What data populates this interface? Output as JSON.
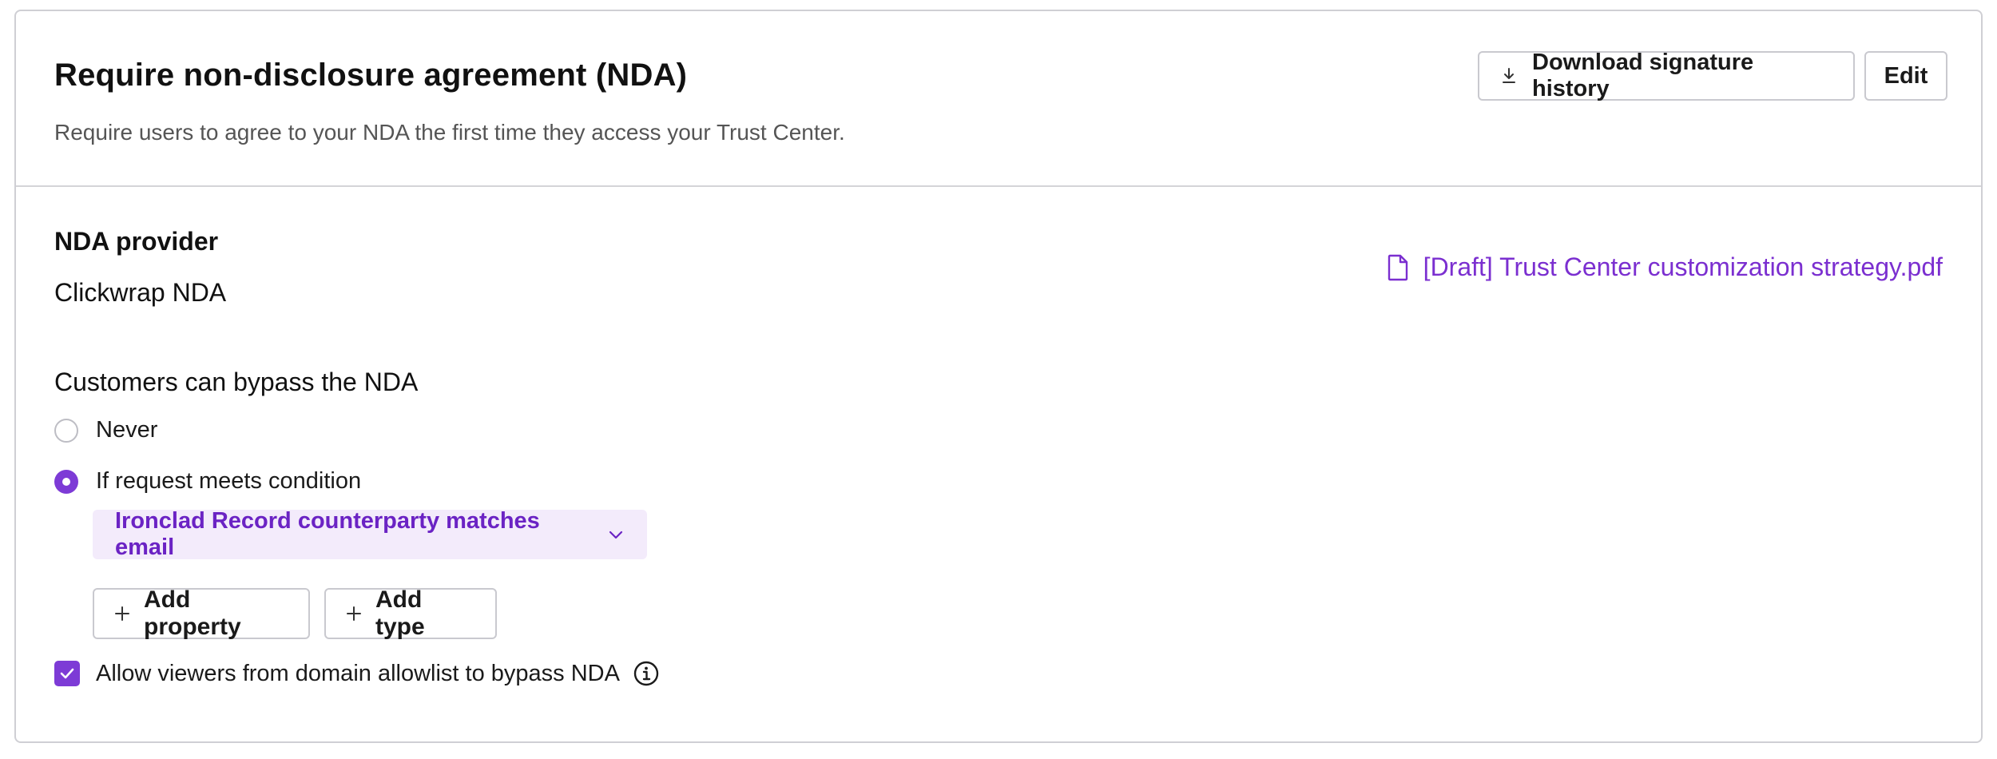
{
  "header": {
    "title": "Require non-disclosure agreement (NDA)",
    "subtitle": "Require users to agree to your NDA the first time they access your Trust Center.",
    "download_label": "Download signature history",
    "edit_label": "Edit"
  },
  "provider": {
    "label": "NDA provider",
    "value": "Clickwrap NDA",
    "file_name": "[Draft] Trust Center customization strategy.pdf"
  },
  "bypass": {
    "label": "Customers can bypass the NDA",
    "options": [
      {
        "label": "Never",
        "selected": false
      },
      {
        "label": "If request meets condition",
        "selected": true
      }
    ],
    "condition": "Ironclad Record counterparty matches email",
    "add_property_label": "Add property",
    "add_type_label": "Add type",
    "allowlist_label": "Allow viewers from domain allowlist to bypass NDA",
    "allowlist_checked": true
  },
  "colors": {
    "accent": "#7d3bd6",
    "chip_bg": "#f3ebfb",
    "link": "#7b2fd0"
  },
  "icons": {
    "download": "download-icon",
    "file": "file-icon",
    "chevron": "chevron-down-icon",
    "plus": "plus-icon",
    "check": "check-icon",
    "info": "info-icon"
  }
}
